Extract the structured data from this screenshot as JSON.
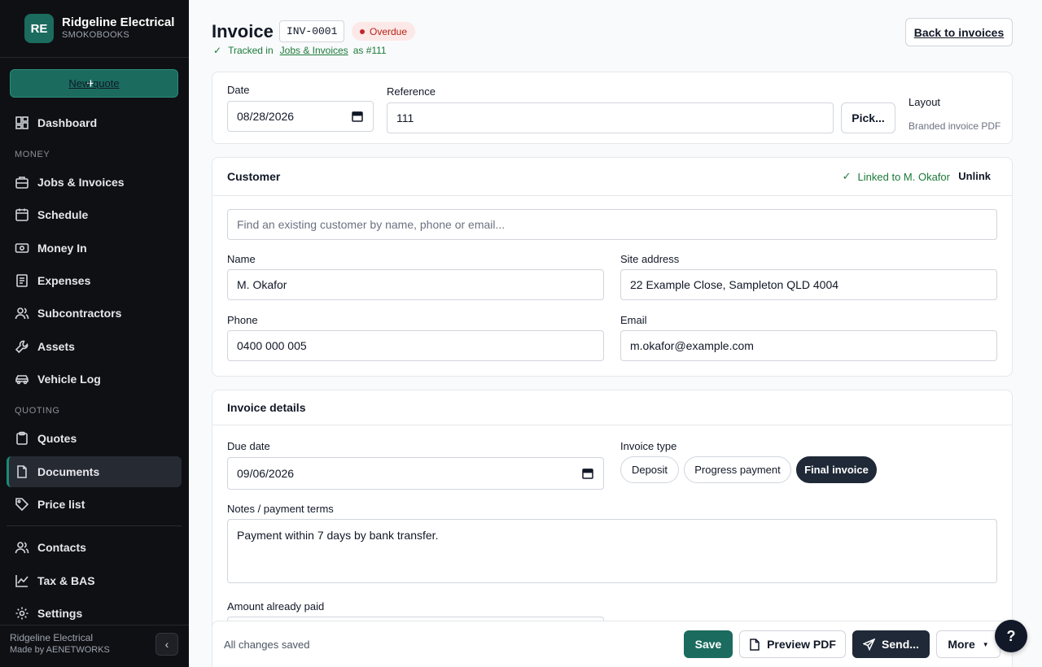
{
  "brand": {
    "initials": "RE",
    "name": "Ridgeline Electrical",
    "sub": "SMOKOBOOKS"
  },
  "sidebar": {
    "new_quote": "New quote",
    "items": [
      {
        "label": "Dashboard",
        "icon": "dashboard-icon"
      },
      {
        "label": "Jobs & Invoices",
        "icon": "briefcase-icon"
      },
      {
        "label": "Schedule",
        "icon": "calendar-icon"
      },
      {
        "label": "Money In",
        "icon": "banknote-icon"
      },
      {
        "label": "Expenses",
        "icon": "receipt-icon"
      },
      {
        "label": "Subcontractors",
        "icon": "users-icon"
      },
      {
        "label": "Assets",
        "icon": "wrench-icon"
      },
      {
        "label": "Vehicle Log",
        "icon": "car-icon"
      },
      {
        "label": "Quotes",
        "icon": "clipboard-icon"
      },
      {
        "label": "Documents",
        "icon": "document-icon"
      },
      {
        "label": "Price list",
        "icon": "tag-icon"
      },
      {
        "label": "Contacts",
        "icon": "contacts-icon"
      },
      {
        "label": "Tax & BAS",
        "icon": "chart-line-icon"
      },
      {
        "label": "Settings",
        "icon": "gear-icon"
      }
    ],
    "sections": {
      "money": "MONEY",
      "quoting": "QUOTING"
    },
    "footer": {
      "company": "Ridgeline Electrical",
      "made_by": "Made by AENETWORKS"
    }
  },
  "header": {
    "title": "Invoice",
    "number": "INV-0001",
    "status": "Overdue",
    "tracked_prefix": "Tracked in",
    "tracked_link": "Jobs & Invoices",
    "tracked_suffix": "as #111",
    "back": "Back to invoices"
  },
  "meta": {
    "date_label": "Date",
    "date_value": "08/28/2026",
    "reference_label": "Reference",
    "reference_value": "111",
    "pick": "Pick...",
    "layout_label": "Layout",
    "layout_value": "Branded invoice PDF"
  },
  "customer": {
    "heading": "Customer",
    "linked": "Linked to M. Okafor",
    "unlink": "Unlink",
    "search_placeholder": "Find an existing customer by name, phone or email...",
    "name_label": "Name",
    "name_value": "M. Okafor",
    "site_label": "Site address",
    "site_value": "22 Example Close, Sampleton QLD 4004",
    "phone_label": "Phone",
    "phone_value": "0400 000 005",
    "email_label": "Email",
    "email_value": "m.okafor@example.com"
  },
  "details": {
    "heading": "Invoice details",
    "due_label": "Due date",
    "due_value": "09/06/2026",
    "type_label": "Invoice type",
    "types": [
      "Deposit",
      "Progress payment",
      "Final invoice"
    ],
    "selected_type": "Final invoice",
    "notes_label": "Notes / payment terms",
    "notes_value": "Payment within 7 days by bank transfer.",
    "paid_label": "Amount already paid"
  },
  "footer": {
    "saved": "All changes saved",
    "save": "Save",
    "preview": "Preview PDF",
    "send": "Send...",
    "more": "More",
    "help": "?"
  },
  "colors": {
    "brand": "#1b6b5e",
    "sidebar_bg": "#0f1013",
    "overdue": "#c0262d",
    "success": "#1b7a3a",
    "dark_button": "#1f2937"
  }
}
